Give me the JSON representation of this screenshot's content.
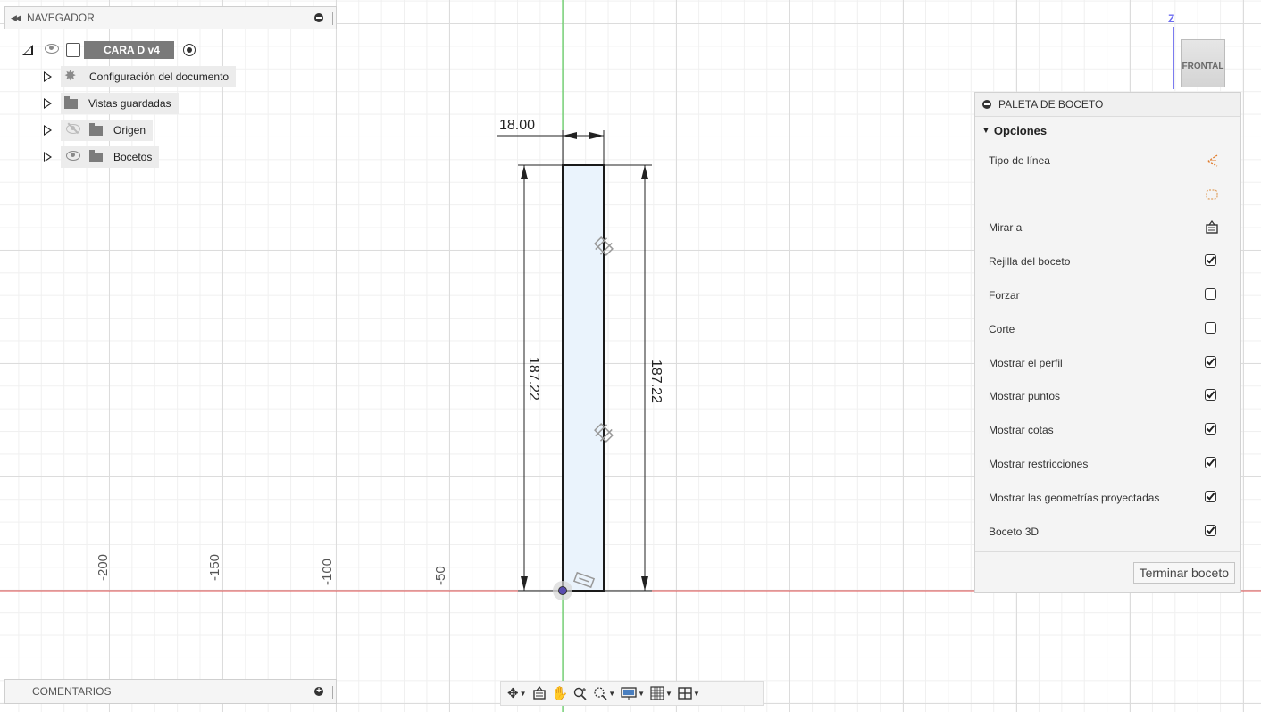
{
  "navigator": {
    "title": "NAVEGADOR",
    "root": {
      "label": "CARA D v4"
    },
    "items": [
      {
        "label": "Configuración del documento",
        "icon": "gear-icon",
        "visibility": "none"
      },
      {
        "label": "Vistas guardadas",
        "icon": "folder-icon",
        "visibility": "none"
      },
      {
        "label": "Origen",
        "icon": "folder-icon",
        "visibility": "hidden"
      },
      {
        "label": "Bocetos",
        "icon": "folder-icon",
        "visibility": "visible"
      }
    ]
  },
  "comments": {
    "title": "COMENTARIOS"
  },
  "sketch": {
    "width_dimension": "18.00",
    "height_dimension_left": "187.22",
    "height_dimension_right": "187.22",
    "ruler_labels": [
      "-200",
      "-150",
      "-100",
      "-50"
    ]
  },
  "viewcube": {
    "face_label": "FRONTAL",
    "axis_label": "Z"
  },
  "palette": {
    "title": "PALETA DE BOCETO",
    "section_label": "Opciones",
    "options": [
      {
        "label": "Tipo de línea",
        "control": "linetype-icon"
      },
      {
        "label": "",
        "control": "construction-icon"
      },
      {
        "label": "Mirar a",
        "control": "look-at-icon"
      },
      {
        "label": "Rejilla del boceto",
        "control": "checkbox",
        "checked": true
      },
      {
        "label": "Forzar",
        "control": "checkbox",
        "checked": false
      },
      {
        "label": "Corte",
        "control": "checkbox",
        "checked": false
      },
      {
        "label": "Mostrar el perfil",
        "control": "checkbox",
        "checked": true
      },
      {
        "label": "Mostrar puntos",
        "control": "checkbox",
        "checked": true
      },
      {
        "label": "Mostrar cotas",
        "control": "checkbox",
        "checked": true
      },
      {
        "label": "Mostrar restricciones",
        "control": "checkbox",
        "checked": true
      },
      {
        "label": "Mostrar las geometrías proyectadas",
        "control": "checkbox",
        "checked": true
      },
      {
        "label": "Boceto 3D",
        "control": "checkbox",
        "checked": true
      }
    ],
    "finish_label": "Terminar boceto"
  },
  "toolbar": {
    "tools": [
      "orbit-icon",
      "look-at-icon",
      "pan-icon",
      "zoom-icon",
      "fit-icon",
      "display-icon",
      "grid-icon",
      "viewports-icon"
    ]
  },
  "colors": {
    "x_axis": "#e05050",
    "y_axis": "#40c840",
    "profile_fill": "#eaf3fc",
    "accent": "#6c6cf0"
  }
}
